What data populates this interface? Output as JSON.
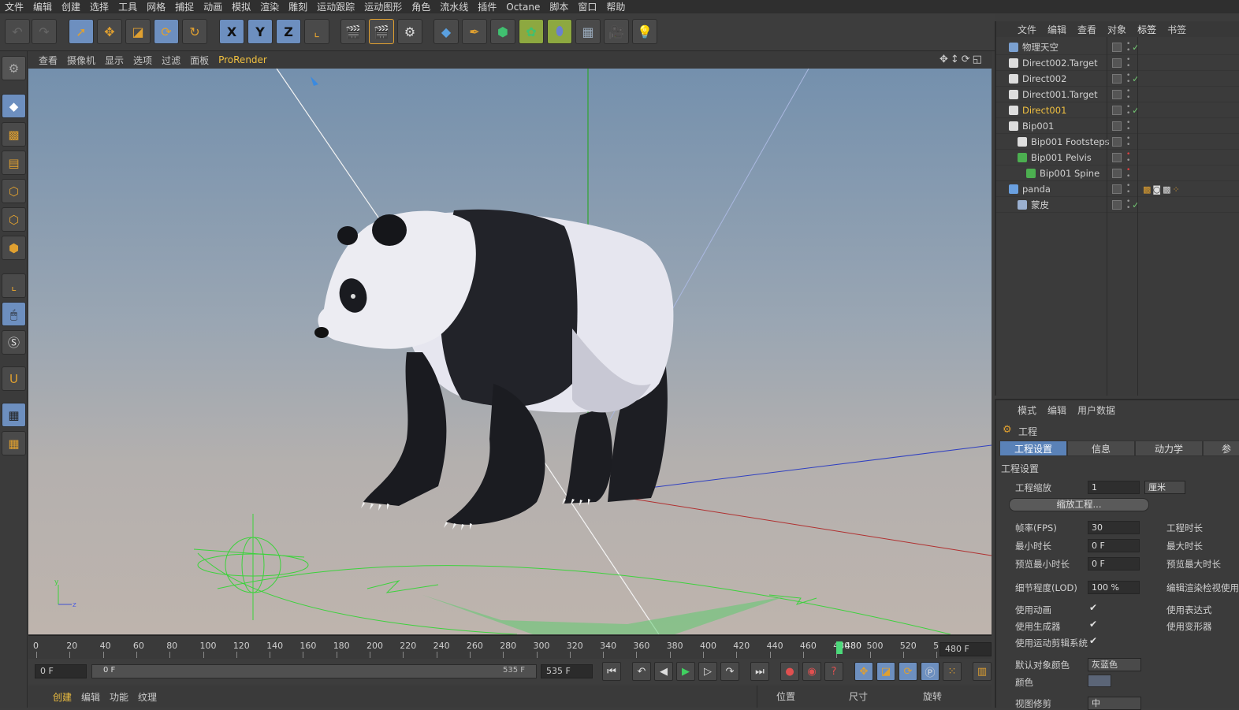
{
  "menubar": [
    "文件",
    "编辑",
    "创建",
    "选择",
    "工具",
    "网格",
    "捕捉",
    "动画",
    "模拟",
    "渲染",
    "雕刻",
    "运动跟踪",
    "运动图形",
    "角色",
    "流水线",
    "插件",
    "Octane",
    "脚本",
    "窗口",
    "帮助"
  ],
  "viewport_menu": [
    "查看",
    "摄像机",
    "显示",
    "选项",
    "过滤",
    "面板",
    "ProRender"
  ],
  "viewport_menu_highlight": "ProRender",
  "axis_buttons": [
    "X",
    "Y",
    "Z"
  ],
  "axis_indicator": {
    "y": "y",
    "z": "z"
  },
  "timeline": {
    "ticks": [
      "0",
      "20",
      "40",
      "60",
      "80",
      "100",
      "120",
      "140",
      "160",
      "180",
      "200",
      "220",
      "240",
      "260",
      "280",
      "300",
      "320",
      "340",
      "360",
      "380",
      "400",
      "420",
      "440",
      "460",
      "480",
      "500",
      "520",
      "5"
    ],
    "current_frame": "480",
    "end_field": "480 F"
  },
  "playbar": {
    "start_field": "0 F",
    "range_start": "0 F",
    "range_end": "535 F",
    "end_field": "535 F"
  },
  "bottombar": {
    "tabs": [
      "创建",
      "编辑",
      "功能",
      "纹理"
    ],
    "coord_headers": [
      "位置",
      "尺寸",
      "旋转"
    ]
  },
  "object_manager": {
    "menu": [
      "文件",
      "编辑",
      "查看",
      "对象",
      "标签",
      "书签"
    ],
    "menu_highlight": "标签",
    "objects": [
      {
        "name": "物理天空",
        "indent": 0,
        "icon": "sky-icon",
        "color": "#7aa0d0",
        "check": true
      },
      {
        "name": "Direct002.Target",
        "indent": 0,
        "icon": "null-icon",
        "color": "#ddd",
        "check": false
      },
      {
        "name": "Direct002",
        "indent": 0,
        "icon": "light-icon",
        "color": "#ddd",
        "check": true
      },
      {
        "name": "Direct001.Target",
        "indent": 0,
        "icon": "null-icon",
        "color": "#ddd",
        "check": false
      },
      {
        "name": "Direct001",
        "indent": 0,
        "icon": "light-icon",
        "color": "#ddd",
        "check": true,
        "selected": true
      },
      {
        "name": "Bip001",
        "indent": 0,
        "icon": "null-icon",
        "color": "#ddd",
        "check": false
      },
      {
        "name": "Bip001 Footsteps",
        "indent": 1,
        "icon": "null-icon",
        "color": "#ddd",
        "check": false
      },
      {
        "name": "Bip001 Pelvis",
        "indent": 1,
        "icon": "bone-icon",
        "color": "#4caf50",
        "check": false,
        "red": true
      },
      {
        "name": "Bip001 Spine",
        "indent": 2,
        "icon": "bone-icon",
        "color": "#4caf50",
        "check": false,
        "red": true
      },
      {
        "name": "panda",
        "indent": 0,
        "icon": "poly-icon",
        "color": "#6aa0e0",
        "check": false
      },
      {
        "name": "蒙皮",
        "indent": 1,
        "icon": "skin-icon",
        "color": "#9ab0d0",
        "check": true
      }
    ]
  },
  "attributes": {
    "menu": [
      "模式",
      "编辑",
      "用户数据"
    ],
    "title": "工程",
    "tabs": [
      "工程设置",
      "信息",
      "动力学",
      "参"
    ],
    "section": "工程设置",
    "scale_label": "工程缩放",
    "scale_value": "1",
    "scale_unit": "厘米",
    "scale_button": "缩放工程...",
    "fps_label": "帧率(FPS)",
    "fps_value": "30",
    "min_time_label": "最小时长",
    "min_time_value": "0 F",
    "preview_min_label": "预览最小时长",
    "preview_min_value": "0 F",
    "project_len_label": "工程时长",
    "max_time_label": "最大时长",
    "preview_max_label": "预览最大时长",
    "lod_label": "细节程度(LOD)",
    "lod_value": "100 %",
    "render_lod_label": "编辑渲染检视使用",
    "use_anim_label": "使用动画",
    "use_gen_label": "使用生成器",
    "use_motion_label": "使用运动剪辑系统",
    "use_expr_label": "使用表达式",
    "use_deform_label": "使用变形器",
    "default_color_label": "默认对象颜色",
    "default_color_value": "灰蓝色",
    "color_label": "颜色",
    "view_clip_label": "视图修剪",
    "view_clip_value": "中"
  },
  "colors": {
    "accent": "#5a82b8",
    "highlight": "#f0c040",
    "sky_top": "#7490ad",
    "sky_bottom": "#beb4ad"
  }
}
